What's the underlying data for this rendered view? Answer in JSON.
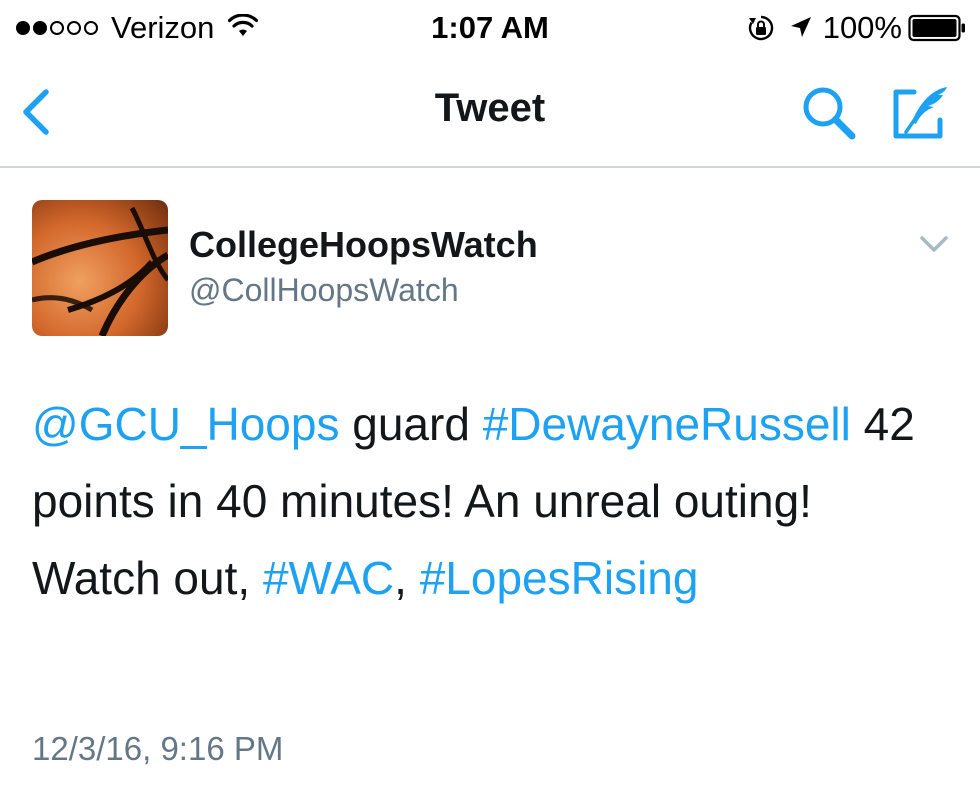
{
  "status_bar": {
    "carrier": "Verizon",
    "time": "1:07 AM",
    "battery": "100%",
    "signal_bars_filled": 2,
    "signal_bars_total": 5
  },
  "nav": {
    "title": "Tweet",
    "back_icon": "chevron-left-icon",
    "search_icon": "search-icon",
    "compose_icon": "compose-icon"
  },
  "tweet": {
    "display_name": "CollegeHoopsWatch",
    "handle": "@CollHoopsWatch",
    "text": {
      "mention": "@GCU_Hoops",
      "part1": " guard ",
      "hashtag1": "#DewayneRussell",
      "part2": " 42 points in 40 minutes! An unreal outing! Watch out, ",
      "hashtag2": "#WAC",
      "part3": ", ",
      "hashtag3": "#LopesRising"
    },
    "timestamp": "12/3/16, 9:16 PM"
  },
  "colors": {
    "accent": "#1da1f2",
    "text": "#14171a",
    "secondary_text": "#657786",
    "divider": "#d3d6d9"
  }
}
